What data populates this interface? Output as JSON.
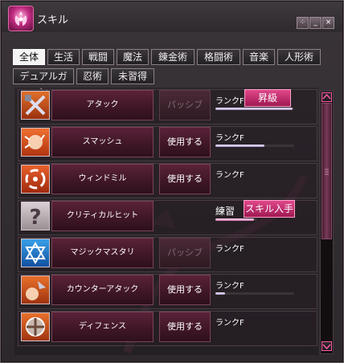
{
  "window": {
    "title": "スキル"
  },
  "title_buttons": [
    "⁘",
    "_",
    "×"
  ],
  "tabs_row1": [
    {
      "label": "全体",
      "active": true
    },
    {
      "label": "生活"
    },
    {
      "label": "戦闘"
    },
    {
      "label": "魔法"
    },
    {
      "label": "錬金術"
    },
    {
      "label": "格闘術"
    },
    {
      "label": "音楽"
    },
    {
      "label": "人形術"
    }
  ],
  "tabs_row2": [
    {
      "label": "デュアルガン"
    },
    {
      "label": "忍術"
    },
    {
      "label": "未習得"
    }
  ],
  "skills": [
    {
      "name": "アタック",
      "icon": "attack-icon",
      "use": "パッシブ",
      "use_enabled": false,
      "rank": "ランクF",
      "rank_progress": 0.98,
      "action": "昇級"
    },
    {
      "name": "スマッシュ",
      "icon": "smash-icon",
      "use": "使用する",
      "use_enabled": true,
      "rank": "ランクF",
      "rank_progress": 0.62
    },
    {
      "name": "ウィンドミル",
      "icon": "windmill-icon",
      "use": "使用する",
      "use_enabled": true,
      "rank": "ランクF",
      "rank_progress": 0
    },
    {
      "name": "クリティカルヒット",
      "icon": "unknown-icon",
      "use": "",
      "use_enabled": false,
      "rank": "練習",
      "rank_progress": 0.48,
      "action": "スキル入手"
    },
    {
      "name": "マジックマスタリ",
      "icon": "hexagram-icon",
      "use": "パッシブ",
      "use_enabled": false,
      "rank": "ランクF",
      "rank_progress": 0
    },
    {
      "name": "カウンターアタック",
      "icon": "counter-icon",
      "use": "使用する",
      "use_enabled": true,
      "rank": "ランクF",
      "rank_progress": 0.12
    },
    {
      "name": "ディフェンス",
      "icon": "shield-icon",
      "use": "使用する",
      "use_enabled": true,
      "rank": "ランクF",
      "rank_progress": 0
    }
  ]
}
